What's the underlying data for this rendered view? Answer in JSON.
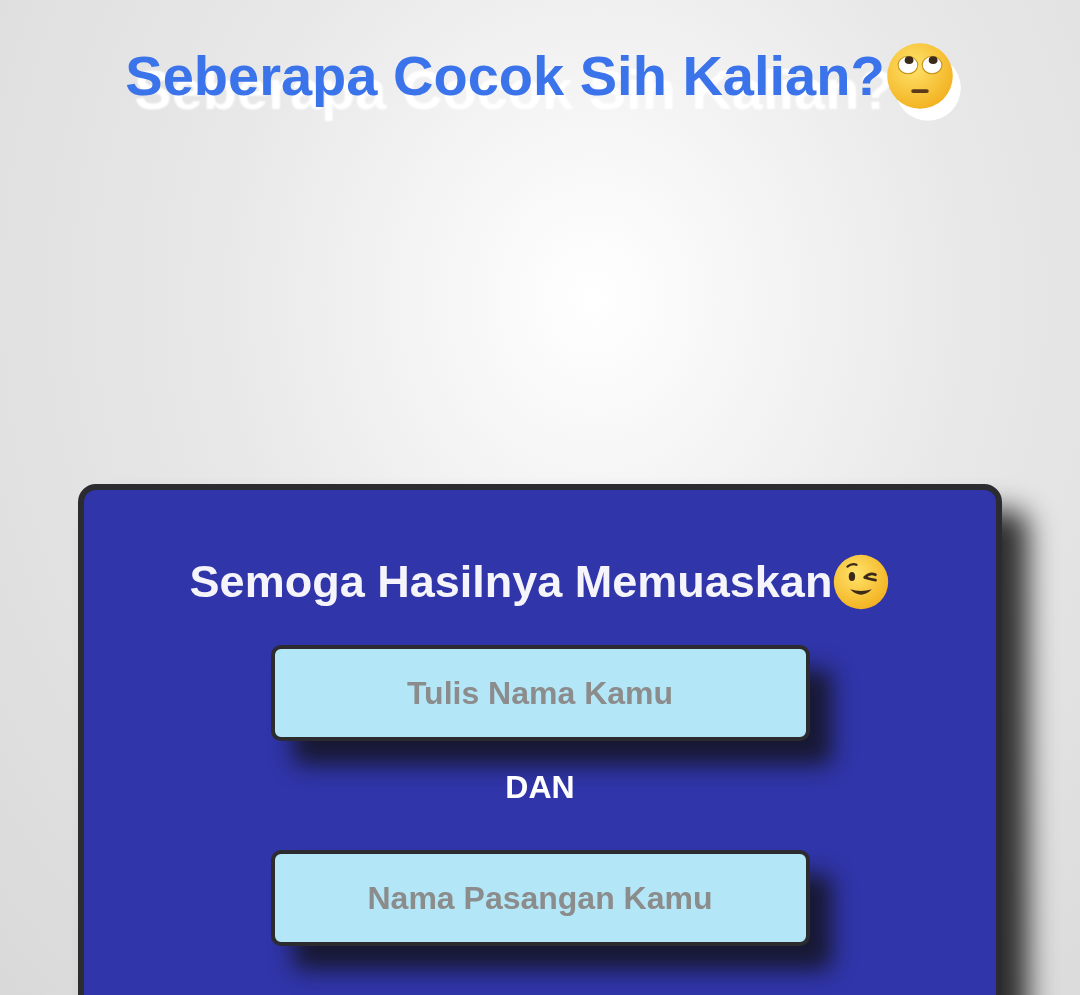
{
  "title": {
    "text": "Seberapa Cocok Sih Kalian?"
  },
  "card": {
    "heading": "Semoga Hasilnya Memuaskan",
    "fields": [
      {
        "placeholder": "Tulis Nama Kamu"
      },
      {
        "placeholder": "Nama Pasangan Kamu"
      }
    ],
    "conjunction": "DAN"
  }
}
